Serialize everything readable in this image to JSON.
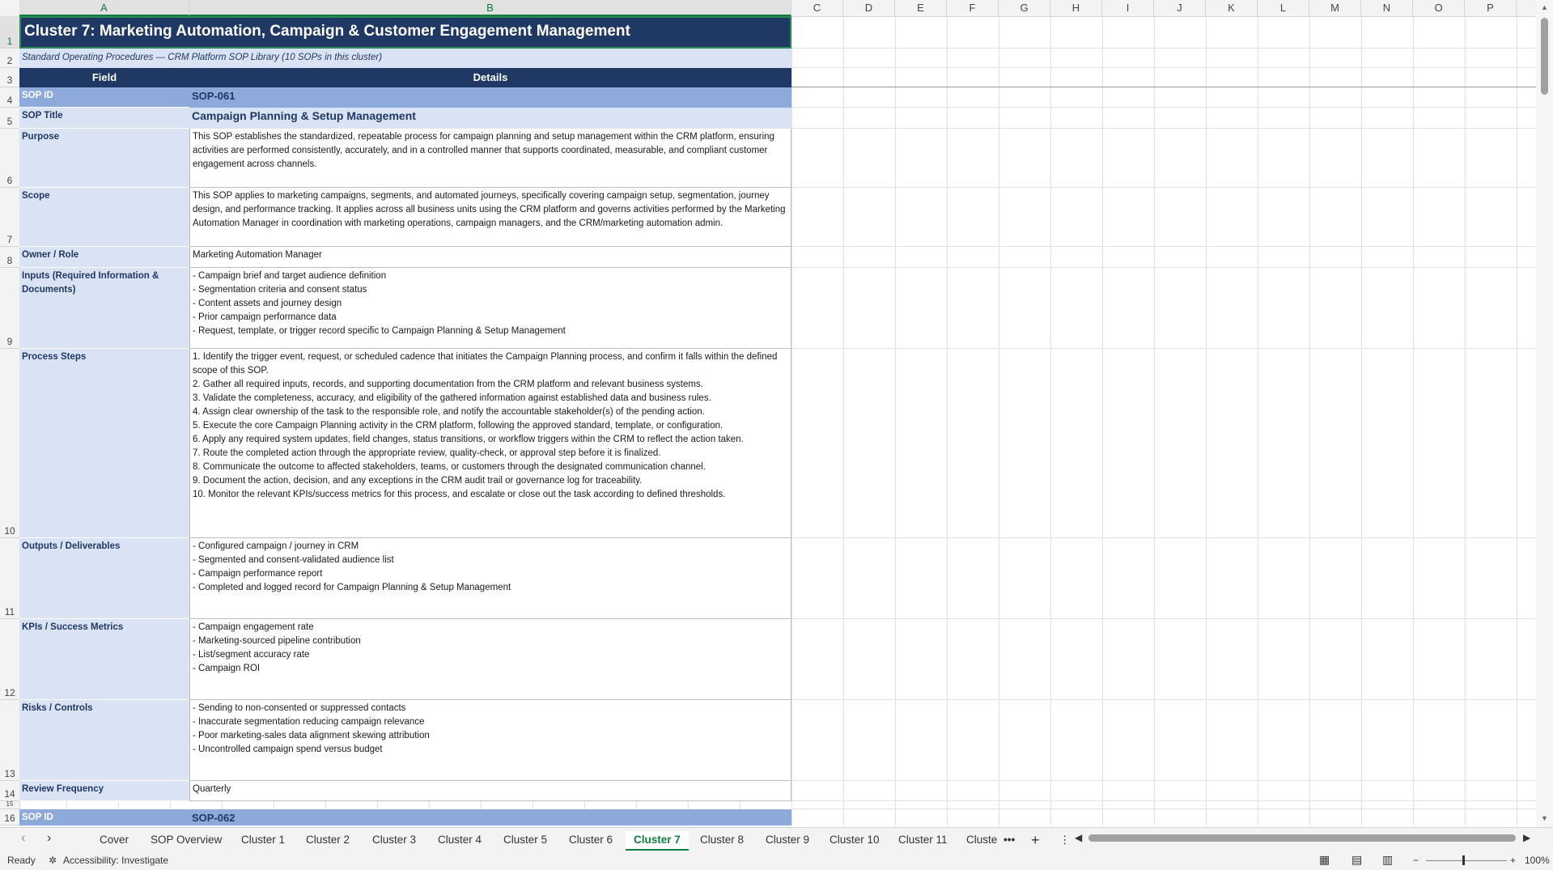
{
  "columns": [
    "A",
    "B",
    "C",
    "D",
    "E",
    "F",
    "G",
    "H",
    "I",
    "J",
    "K",
    "L",
    "M",
    "N",
    "O",
    "P"
  ],
  "rows": [
    "1",
    "2",
    "3",
    "4",
    "5",
    "6",
    "7",
    "8",
    "9",
    "10",
    "11",
    "12",
    "13",
    "14",
    "15",
    "16"
  ],
  "sheet": {
    "title": "Cluster 7: Marketing Automation, Campaign & Customer Engagement Management",
    "subtitle": "Standard Operating Procedures — CRM Platform SOP Library (10 SOPs in this cluster)",
    "header_field": "Field",
    "header_details": "Details",
    "records": [
      {
        "label": "SOP ID",
        "value": "SOP-061"
      },
      {
        "label": "SOP Title",
        "value": "Campaign Planning & Setup Management"
      },
      {
        "label": "Purpose",
        "value": "This SOP establishes the standardized, repeatable process for campaign planning and setup management within the CRM platform, ensuring activities are performed consistently, accurately, and in a controlled manner that supports coordinated, measurable, and compliant customer engagement across channels."
      },
      {
        "label": "Scope",
        "value": "This SOP applies to marketing campaigns, segments, and automated journeys, specifically covering campaign setup, segmentation, journey design, and performance tracking. It applies across all business units using the CRM platform and governs activities performed by the Marketing Automation Manager in coordination with marketing operations, campaign managers, and the CRM/marketing automation admin."
      },
      {
        "label": "Owner / Role",
        "value": "Marketing Automation Manager"
      },
      {
        "label": "Inputs (Required Information & Documents)",
        "value": "- Campaign brief and target audience definition\n- Segmentation criteria and consent status\n- Content assets and journey design\n- Prior campaign performance data\n- Request, template, or trigger record specific to Campaign Planning & Setup Management"
      },
      {
        "label": "Process Steps",
        "value": "1. Identify the trigger event, request, or scheduled cadence that initiates the Campaign Planning process, and confirm it falls within the defined scope of this SOP.\n2. Gather all required inputs, records, and supporting documentation from the CRM platform and relevant business systems.\n3. Validate the completeness, accuracy, and eligibility of the gathered information against established data and business rules.\n4. Assign clear ownership of the task to the responsible role, and notify the accountable stakeholder(s) of the pending action.\n5. Execute the core Campaign Planning activity in the CRM platform, following the approved standard, template, or configuration.\n6. Apply any required system updates, field changes, status transitions, or workflow triggers within the CRM to reflect the action taken.\n7. Route the completed action through the appropriate review, quality-check, or approval step before it is finalized.\n8. Communicate the outcome to affected stakeholders, teams, or customers through the designated communication channel.\n9. Document the action, decision, and any exceptions in the CRM audit trail or governance log for traceability.\n10. Monitor the relevant KPIs/success metrics for this process, and escalate or close out the task according to defined thresholds."
      },
      {
        "label": "Outputs / Deliverables",
        "value": "- Configured campaign / journey in CRM\n- Segmented and consent-validated audience list\n- Campaign performance report\n- Completed and logged record for Campaign Planning & Setup Management"
      },
      {
        "label": "KPIs / Success Metrics",
        "value": "- Campaign engagement rate\n- Marketing-sourced pipeline contribution\n- List/segment accuracy rate\n- Campaign ROI"
      },
      {
        "label": "Risks / Controls",
        "value": "- Sending to non-consented or suppressed contacts\n- Inaccurate segmentation reducing campaign relevance\n- Poor marketing-sales data alignment skewing attribution\n- Uncontrolled campaign spend versus budget"
      },
      {
        "label": "Review Frequency",
        "value": "Quarterly"
      },
      {
        "label": "SOP ID",
        "value": "SOP-062"
      }
    ]
  },
  "tabs": [
    "Cover",
    "SOP Overview",
    "Cluster 1",
    "Cluster 2",
    "Cluster 3",
    "Cluster 4",
    "Cluster 5",
    "Cluster 6",
    "Cluster 7",
    "Cluster 8",
    "Cluster 9",
    "Cluster 10",
    "Cluster 11",
    "Cluste"
  ],
  "active_tab": "Cluster 7",
  "tab_more": "•••",
  "tab_add": "+",
  "status": {
    "ready": "Ready",
    "accessibility": "Accessibility: Investigate",
    "zoom": "100%"
  },
  "colors": {
    "header_navy": "#1f3864",
    "label_bg": "#dae3f3",
    "id_bg": "#8eaadb",
    "excel_green": "#107c41"
  }
}
